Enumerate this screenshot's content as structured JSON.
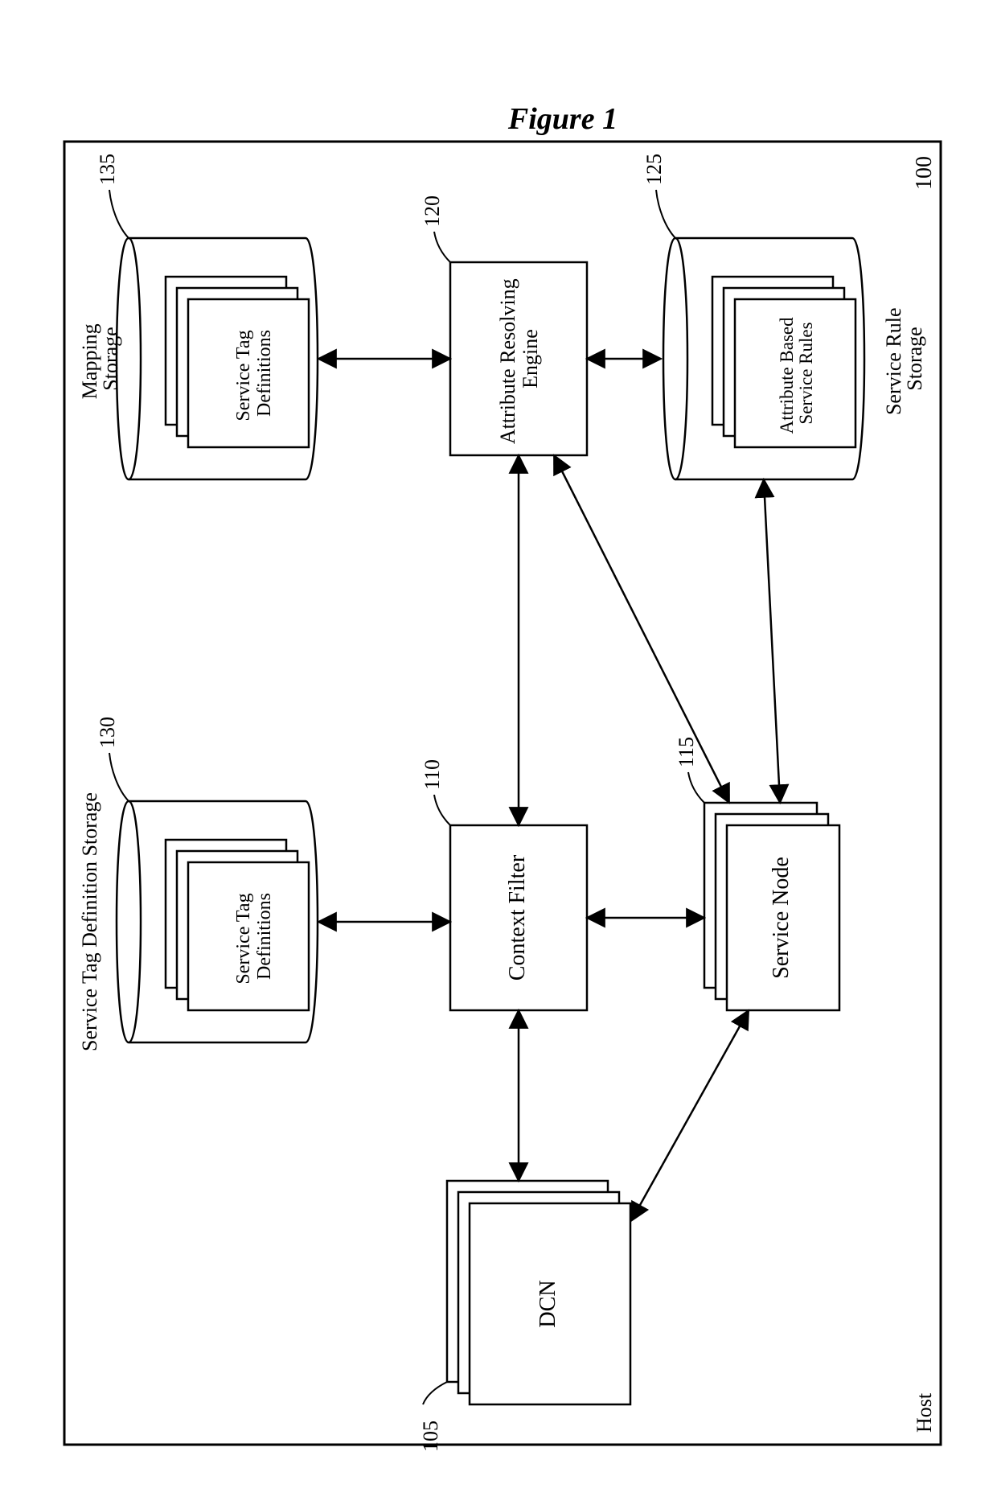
{
  "figure_caption": "Figure 1",
  "host_label": "Host",
  "num_host": "100",
  "components": {
    "dcn": {
      "label": "DCN",
      "num": "105"
    },
    "context_filter": {
      "label": "Context Filter",
      "num": "110"
    },
    "service_node": {
      "label": "Service Node",
      "num": "115"
    },
    "attribute_engine": {
      "label": "Attribute Resolving Engine",
      "num": "120"
    },
    "abs_rules": {
      "label": "Attribute Based Service Rules",
      "num": "125"
    },
    "service_rule_storage_label": "Service Rule Storage",
    "std_left": {
      "label": "Service Tag Definitions",
      "num": "130",
      "storage_label": "Service Tag Definition Storage"
    },
    "std_right": {
      "label": "Service Tag Definitions",
      "num": "135",
      "storage_label": "Mapping Storage"
    }
  }
}
